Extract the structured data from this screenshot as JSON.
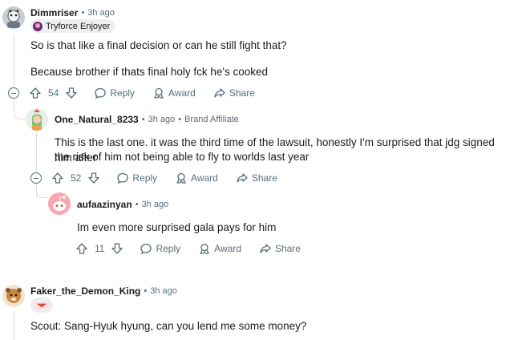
{
  "comments": [
    {
      "username": "Dimmriser",
      "sep": "•",
      "time": "3h ago",
      "flair": "Tryforce Enjoyer",
      "paragraphs": [
        "So is that like a final decision or can he still fight that?",
        "Because brother if thats final holy fck he's cooked"
      ],
      "votes": "54",
      "reply_label": "Reply",
      "award_label": "Award",
      "share_label": "Share"
    },
    {
      "username": "One_Natural_8233",
      "sep": "•",
      "time": "3h ago",
      "sep2": "•",
      "badge": "Brand Affiliate",
      "paragraphs": [
        "This is the last one. it was the third time of the lawsuit, honestly I'm surprised that jdg signed him after",
        "the risk of him not being able to fly to worlds last year"
      ],
      "votes": "52",
      "reply_label": "Reply",
      "award_label": "Award",
      "share_label": "Share"
    },
    {
      "username": "aufaazinyan",
      "sep": "•",
      "time": "3h ago",
      "paragraphs": [
        "Im even more surprised gala pays for him"
      ],
      "votes": "11",
      "reply_label": "Reply",
      "award_label": "Award",
      "share_label": "Share"
    },
    {
      "username": "Faker_the_Demon_King",
      "sep": "•",
      "time": "3h ago",
      "paragraphs": [
        "Scout: Sang-Hyuk hyung, can you lend me some money?"
      ]
    }
  ],
  "colors": {
    "text": "#1c1c1c",
    "meta": "#576f76",
    "thread_line": "#dadcde",
    "flair_bg": "#edeff1",
    "snoo": "#ff4500"
  },
  "icons": [
    "upvote-icon",
    "downvote-icon",
    "reply-bubble-icon",
    "award-icon",
    "share-icon",
    "collapse-icon"
  ]
}
